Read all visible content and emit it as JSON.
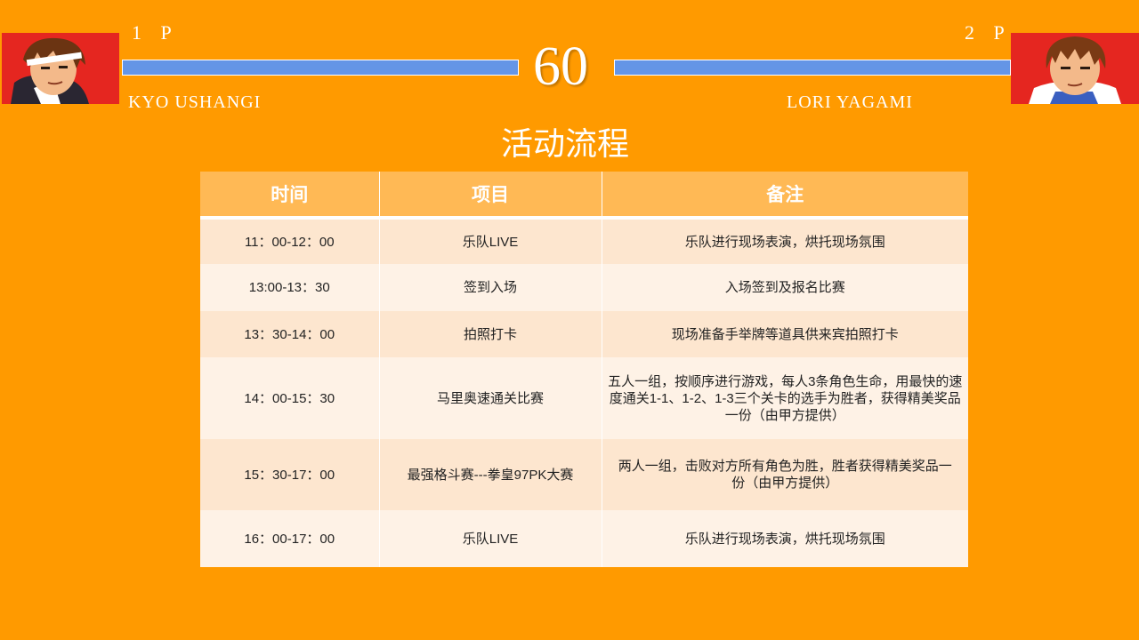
{
  "hud": {
    "p1": {
      "tag": "1 P",
      "name": "KYO USHANGI",
      "health": 1.0
    },
    "p2": {
      "tag": "2 P",
      "name": "LORI  YAGAMI",
      "health": 1.0
    },
    "timer": "60"
  },
  "title": "活动流程",
  "table": {
    "headers": [
      "时间",
      "项目",
      "备注"
    ],
    "rows": [
      {
        "time": "11：00-12：00",
        "item": "乐队LIVE",
        "note": "乐队进行现场表演，烘托现场氛围"
      },
      {
        "time": "13:00-13：30",
        "item": "签到入场",
        "note": "入场签到及报名比赛"
      },
      {
        "time": "13：30-14：00",
        "item": "拍照打卡",
        "note": "现场准备手举牌等道具供来宾拍照打卡"
      },
      {
        "time": "14：00-15：30",
        "item": "马里奥速通关比赛",
        "note": "五人一组，按顺序进行游戏，每人3条角色生命，用最快的速度通关1-1、1-2、1-3三个关卡的选手为胜者，获得精美奖品一份（由甲方提供）"
      },
      {
        "time": "15：30-17：00",
        "item": "最强格斗赛---拳皇97PK大赛",
        "note": "两人一组，击败对方所有角色为胜，胜者获得精美奖品一份（由甲方提供）"
      },
      {
        "time": "16：00-17：00",
        "item": "乐队LIVE",
        "note": "乐队进行现场表演，烘托现场氛围"
      }
    ]
  },
  "colors": {
    "background": "#FF9A00",
    "health_bar": "#6495e6",
    "table_header": "#FFB955",
    "row_odd": "#FDE6CF",
    "row_even": "#FEF2E6"
  }
}
